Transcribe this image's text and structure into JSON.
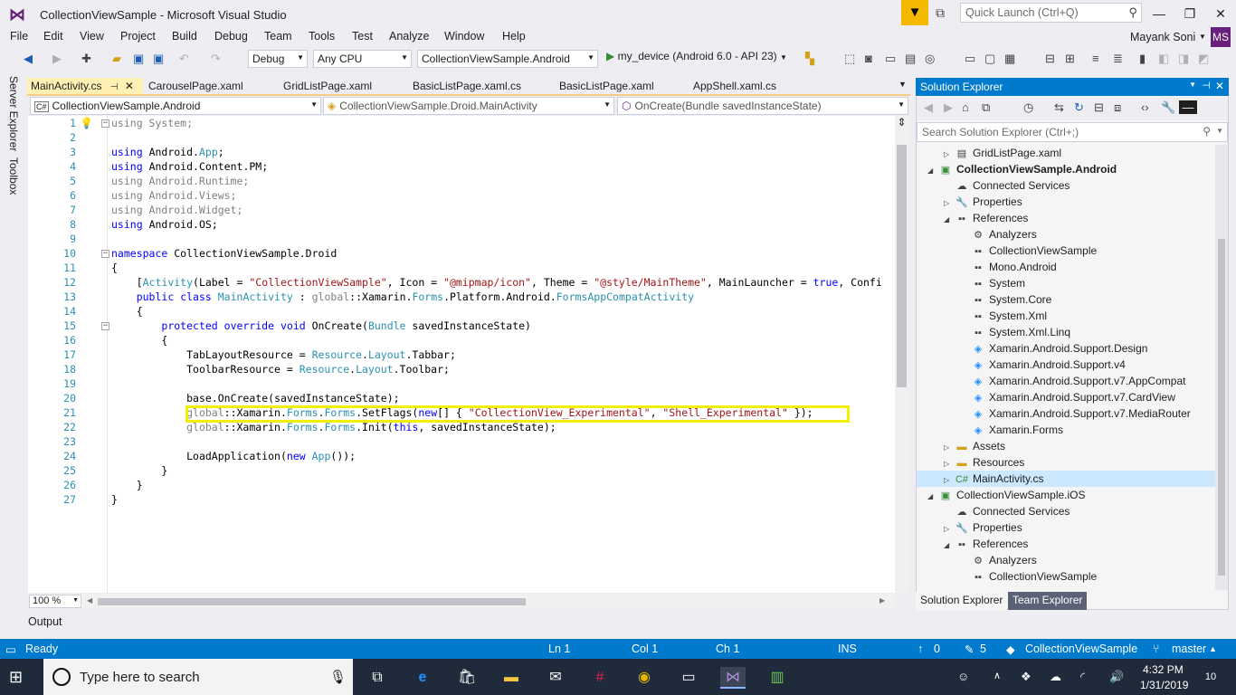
{
  "window": {
    "title": "CollectionViewSample - Microsoft Visual Studio",
    "quick_launch_placeholder": "Quick Launch (Ctrl+Q)"
  },
  "menu": [
    "File",
    "Edit",
    "View",
    "Project",
    "Build",
    "Debug",
    "Team",
    "Tools",
    "Test",
    "Analyze",
    "Window",
    "Help"
  ],
  "user": {
    "name": "Mayank Soni",
    "initials": "MS"
  },
  "toolbar": {
    "configuration": "Debug",
    "platform": "Any CPU",
    "startup_project": "CollectionViewSample.Android",
    "run_target": "my_device (Android 6.0 - API 23)"
  },
  "side_tabs": [
    "Server Explorer",
    "Toolbox"
  ],
  "editor_tabs": [
    "MainActivity.cs",
    "CarouselPage.xaml",
    "GridListPage.xaml",
    "BasicListPage.xaml.cs",
    "BasicListPage.xaml",
    "AppShell.xaml.cs"
  ],
  "nav": {
    "project": "CollectionViewSample.Android",
    "type": "CollectionViewSample.Droid.MainActivity",
    "member": "OnCreate(Bundle savedInstanceState)"
  },
  "code_lines": [
    "using System;",
    "",
    "using Android.App;",
    "using Android.Content.PM;",
    "using Android.Runtime;",
    "using Android.Views;",
    "using Android.Widget;",
    "using Android.OS;",
    "",
    "namespace CollectionViewSample.Droid",
    "{",
    "    [Activity(Label = \"CollectionViewSample\", Icon = \"@mipmap/icon\", Theme = \"@style/MainTheme\", MainLauncher = true, Confi",
    "    public class MainActivity : global::Xamarin.Forms.Platform.Android.FormsAppCompatActivity",
    "    {",
    "        protected override void OnCreate(Bundle savedInstanceState)",
    "        {",
    "            TabLayoutResource = Resource.Layout.Tabbar;",
    "            ToolbarResource = Resource.Layout.Toolbar;",
    "",
    "            base.OnCreate(savedInstanceState);",
    "            global::Xamarin.Forms.Forms.SetFlags(new[] { \"CollectionView_Experimental\", \"Shell_Experimental\" });",
    "            global::Xamarin.Forms.Forms.Init(this, savedInstanceState);",
    "",
    "            LoadApplication(new App());",
    "        }",
    "    }",
    "}"
  ],
  "line_numbers": [
    "1",
    "2",
    "3",
    "4",
    "5",
    "6",
    "7",
    "8",
    "9",
    "10",
    "11",
    "12",
    "13",
    "14",
    "15",
    "16",
    "17",
    "18",
    "19",
    "20",
    "21",
    "22",
    "23",
    "24",
    "25",
    "26",
    "27"
  ],
  "editor": {
    "zoom": "100 %"
  },
  "solution_explorer": {
    "title": "Solution Explorer",
    "search_placeholder": "Search Solution Explorer (Ctrl+;)",
    "items": [
      {
        "label": "GridListPage.xaml",
        "indent": 1,
        "expander": "▷",
        "icon": "xaml-file-icon"
      },
      {
        "label": "CollectionViewSample.Android",
        "indent": 0,
        "expander": "◢",
        "icon": "csharp-project-icon",
        "bold": true
      },
      {
        "label": "Connected Services",
        "indent": 1,
        "expander": "",
        "icon": "connected-services-icon"
      },
      {
        "label": "Properties",
        "indent": 1,
        "expander": "▷",
        "icon": "wrench-icon"
      },
      {
        "label": "References",
        "indent": 1,
        "expander": "◢",
        "icon": "references-icon"
      },
      {
        "label": "Analyzers",
        "indent": 2,
        "expander": "",
        "icon": "analyzers-icon"
      },
      {
        "label": "CollectionViewSample",
        "indent": 2,
        "expander": "",
        "icon": "reference-icon"
      },
      {
        "label": "Mono.Android",
        "indent": 2,
        "expander": "",
        "icon": "reference-icon"
      },
      {
        "label": "System",
        "indent": 2,
        "expander": "",
        "icon": "reference-icon"
      },
      {
        "label": "System.Core",
        "indent": 2,
        "expander": "",
        "icon": "reference-icon"
      },
      {
        "label": "System.Xml",
        "indent": 2,
        "expander": "",
        "icon": "reference-icon"
      },
      {
        "label": "System.Xml.Linq",
        "indent": 2,
        "expander": "",
        "icon": "reference-icon"
      },
      {
        "label": "Xamarin.Android.Support.Design",
        "indent": 2,
        "expander": "",
        "icon": "package-icon"
      },
      {
        "label": "Xamarin.Android.Support.v4",
        "indent": 2,
        "expander": "",
        "icon": "package-icon"
      },
      {
        "label": "Xamarin.Android.Support.v7.AppCompat",
        "indent": 2,
        "expander": "",
        "icon": "package-icon"
      },
      {
        "label": "Xamarin.Android.Support.v7.CardView",
        "indent": 2,
        "expander": "",
        "icon": "package-icon"
      },
      {
        "label": "Xamarin.Android.Support.v7.MediaRouter",
        "indent": 2,
        "expander": "",
        "icon": "package-icon"
      },
      {
        "label": "Xamarin.Forms",
        "indent": 2,
        "expander": "",
        "icon": "package-icon"
      },
      {
        "label": "Assets",
        "indent": 1,
        "expander": "▷",
        "icon": "folder-icon"
      },
      {
        "label": "Resources",
        "indent": 1,
        "expander": "▷",
        "icon": "folder-icon"
      },
      {
        "label": "MainActivity.cs",
        "indent": 1,
        "expander": "▷",
        "icon": "csharp-file-icon",
        "selected": true
      },
      {
        "label": "CollectionViewSample.iOS",
        "indent": 0,
        "expander": "◢",
        "icon": "csharp-project-icon"
      },
      {
        "label": "Connected Services",
        "indent": 1,
        "expander": "",
        "icon": "connected-services-icon"
      },
      {
        "label": "Properties",
        "indent": 1,
        "expander": "▷",
        "icon": "wrench-icon"
      },
      {
        "label": "References",
        "indent": 1,
        "expander": "◢",
        "icon": "references-icon"
      },
      {
        "label": "Analyzers",
        "indent": 2,
        "expander": "",
        "icon": "analyzers-icon"
      },
      {
        "label": "CollectionViewSample",
        "indent": 2,
        "expander": "",
        "icon": "reference-icon"
      }
    ],
    "bottom_tabs": [
      "Solution Explorer",
      "Team Explorer"
    ]
  },
  "output_label": "Output",
  "status": {
    "state": "Ready",
    "ln": "Ln 1",
    "col": "Col 1",
    "ch": "Ch 1",
    "mode": "INS",
    "up_count": "0",
    "edit_count": "5",
    "repo": "CollectionViewSample",
    "branch": "master"
  },
  "taskbar": {
    "search_placeholder": "Type here to search",
    "time": "4:32 PM",
    "date": "1/31/2019",
    "notifications": "10"
  },
  "colors": {
    "accent": "#007acc",
    "vs_purple": "#68217a",
    "highlight_box": "#f0f000",
    "active_tab": "#fff0b3"
  }
}
